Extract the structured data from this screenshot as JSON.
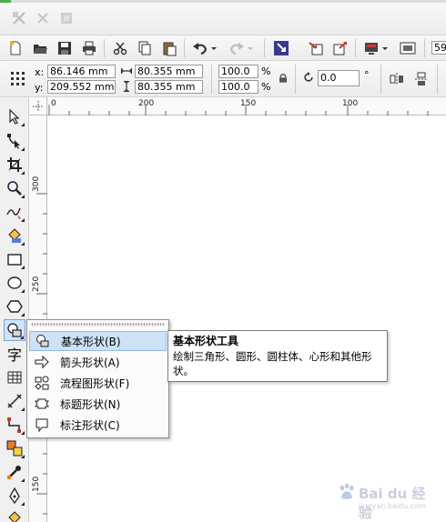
{
  "property_bar": {
    "x_label": "x:",
    "x_value": "86.146 mm",
    "y_label": "y:",
    "y_value": "209.552 mm",
    "width_value": "80.355 mm",
    "height_value": "80.355 mm",
    "scale_x": "100.0",
    "scale_y": "100.0",
    "percent": "%",
    "rotation": "0.0",
    "degree": "°",
    "toolbar_partial": "59"
  },
  "ruler": {
    "horizontal_ticks": [
      "0",
      "200",
      "150",
      "100"
    ],
    "vertical_ticks": [
      "300",
      "250",
      "200",
      "150"
    ]
  },
  "toolbox": {
    "text_tool_glyph": "字"
  },
  "flyout_menu": {
    "items": [
      {
        "label": "基本形状(B)",
        "icon": "basic-shapes-icon",
        "highlighted": true
      },
      {
        "label": "箭头形状(A)",
        "icon": "arrow-shapes-icon",
        "highlighted": false
      },
      {
        "label": "流程图形状(F)",
        "icon": "flowchart-shapes-icon",
        "highlighted": false
      },
      {
        "label": "标题形状(N)",
        "icon": "banner-shapes-icon",
        "highlighted": false
      },
      {
        "label": "标注形状(C)",
        "icon": "callout-shapes-icon",
        "highlighted": false
      }
    ]
  },
  "tooltip": {
    "title": "基本形状工具",
    "description": "绘制三角形、圆形、圆柱体、心形和其他形状。"
  },
  "watermark": {
    "text": "Bai du 经验",
    "subtext": "jingyan.baidu.com"
  },
  "colors": {
    "menu_highlight": "#cde2f7",
    "active_tool": "#cfe3fb",
    "accent_green": "#4caf50"
  }
}
